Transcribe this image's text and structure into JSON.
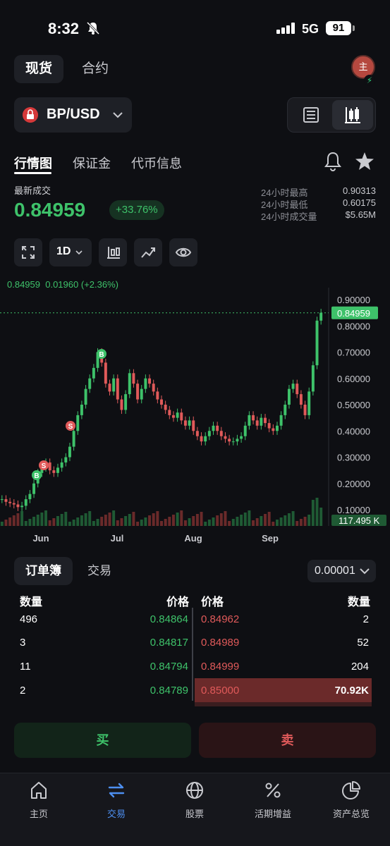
{
  "status_bar": {
    "time": "8:32",
    "network": "5G",
    "battery": "91"
  },
  "top_tabs": {
    "spot": "现货",
    "contract": "合约"
  },
  "avatar_text": "主",
  "pair": {
    "name": "BP/USD"
  },
  "sub_tabs": {
    "market": "行情图",
    "margin": "保证金",
    "token_info": "代币信息"
  },
  "ticker": {
    "last_label": "最新成交",
    "last_price": "0.84959",
    "change_pct": "+33.76%",
    "stats": [
      {
        "label": "24小时最高",
        "value": "0.90313"
      },
      {
        "label": "24小时最低",
        "value": "0.60175"
      },
      {
        "label": "24小时成交量",
        "value": "$5.65M"
      }
    ]
  },
  "toolbar": {
    "interval": "1D"
  },
  "chart_header": {
    "price": "0.84959",
    "change": "0.01960",
    "change_pct": "(+2.36%)"
  },
  "chart_data": {
    "type": "candlestick",
    "y_ticks": [
      "0.90000",
      "0.80000",
      "0.70000",
      "0.60000",
      "0.50000",
      "0.40000",
      "0.30000",
      "0.20000",
      "0.10000"
    ],
    "ylim": [
      0.1,
      0.9
    ],
    "x_ticks": [
      "Jun",
      "Jul",
      "Aug",
      "Sep"
    ],
    "current_price_label": "0.84959",
    "volume_label": "117.495 K",
    "markers": [
      "B",
      "S",
      "S",
      "B"
    ],
    "closes": [
      0.14,
      0.13,
      0.125,
      0.12,
      0.11,
      0.115,
      0.14,
      0.16,
      0.2,
      0.24,
      0.26,
      0.28,
      0.25,
      0.24,
      0.26,
      0.28,
      0.3,
      0.34,
      0.4,
      0.46,
      0.5,
      0.56,
      0.6,
      0.64,
      0.7,
      0.66,
      0.58,
      0.55,
      0.6,
      0.52,
      0.48,
      0.54,
      0.62,
      0.58,
      0.52,
      0.56,
      0.6,
      0.58,
      0.55,
      0.52,
      0.5,
      0.48,
      0.46,
      0.45,
      0.47,
      0.44,
      0.42,
      0.44,
      0.4,
      0.38,
      0.36,
      0.38,
      0.4,
      0.42,
      0.4,
      0.38,
      0.37,
      0.36,
      0.36,
      0.37,
      0.38,
      0.42,
      0.46,
      0.44,
      0.42,
      0.45,
      0.43,
      0.41,
      0.4,
      0.42,
      0.46,
      0.5,
      0.56,
      0.58,
      0.54,
      0.5,
      0.46,
      0.55,
      0.65,
      0.82,
      0.85
    ]
  },
  "order_book": {
    "tabs": {
      "book": "订单簿",
      "trades": "交易"
    },
    "precision": "0.00001",
    "headers": {
      "qty_left": "数量",
      "price_left": "价格",
      "price_right": "价格",
      "qty_right": "数量"
    },
    "rows": [
      {
        "bid_qty": "496",
        "bid_price": "0.84864",
        "ask_price": "0.84962",
        "ask_qty": "2"
      },
      {
        "bid_qty": "3",
        "bid_price": "0.84817",
        "ask_price": "0.84989",
        "ask_qty": "52"
      },
      {
        "bid_qty": "11",
        "bid_price": "0.84794",
        "ask_price": "0.84999",
        "ask_qty": "204"
      },
      {
        "bid_qty": "2",
        "bid_price": "0.84789",
        "ask_price": "0.85000",
        "ask_qty": "70.92K"
      }
    ]
  },
  "actions": {
    "buy": "买",
    "sell": "卖"
  },
  "nav": [
    {
      "label": "主页",
      "icon": "home-icon"
    },
    {
      "label": "交易",
      "icon": "swap-icon"
    },
    {
      "label": "股票",
      "icon": "globe-icon"
    },
    {
      "label": "活期增益",
      "icon": "percent-icon"
    },
    {
      "label": "资产总览",
      "icon": "pie-chart-icon"
    }
  ],
  "colors": {
    "up": "#3ec26a",
    "down": "#e05a5a",
    "accent": "#4d8ff0",
    "bg": "#0e0f13"
  }
}
